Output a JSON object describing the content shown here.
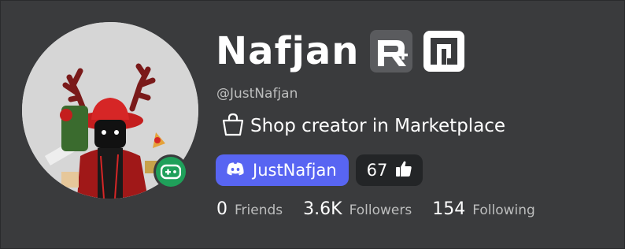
{
  "profile": {
    "display_name": "Nafjan",
    "username": "@JustNafjan",
    "shop_text": "Shop creator in Marketplace",
    "presence": "in-game",
    "badges": [
      "roblox-plus-icon",
      "premium-icon"
    ]
  },
  "social": {
    "discord_label": "JustNafjan",
    "vote_count": "67"
  },
  "stats": [
    {
      "value": "0",
      "label": "Friends"
    },
    {
      "value": "3.6K",
      "label": "Followers"
    },
    {
      "value": "154",
      "label": "Following"
    }
  ],
  "colors": {
    "background": "#3a3b3d",
    "discord": "#5865f2",
    "presence_green": "#1fa05a",
    "secondary_text": "#bdbebe"
  }
}
